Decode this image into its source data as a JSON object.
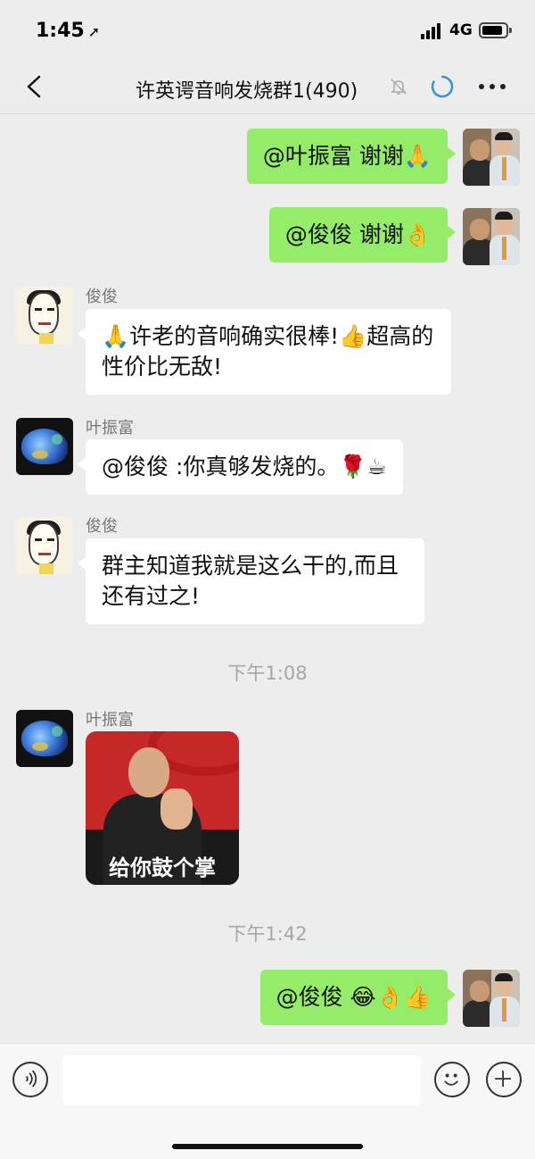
{
  "status_bar": {
    "time": "1:45",
    "network": "4G"
  },
  "nav": {
    "title": "许英谔音响发烧群1(490)"
  },
  "messages": [
    {
      "sender": "",
      "text": "@叶振富 谢谢🙏"
    },
    {
      "sender": "",
      "text": "@俊俊 谢谢👌"
    },
    {
      "sender": "俊俊",
      "text": "🙏许老的音响确实很棒!👍超高的性价比无敌!"
    },
    {
      "sender": "叶振富",
      "text": "@俊俊 :你真够发烧的。🌹☕"
    },
    {
      "sender": "俊俊",
      "text": "群主知道我就是这么干的,而且还有过之!"
    },
    {
      "sender": "叶振富",
      "sticker_caption": "给你鼓个掌"
    },
    {
      "sender": "",
      "text": "@俊俊 😂👌👍"
    }
  ],
  "timestamps": [
    "下午1:08",
    "下午1:42"
  ],
  "icons": {
    "back": "chevron-left-icon",
    "mute": "bell-muted-icon",
    "loading": "loading-circle-icon",
    "more": "more-dots-icon",
    "voice": "voice-icon",
    "emoji": "smiley-icon",
    "plus": "plus-icon"
  },
  "colors": {
    "outgoing_bubble": "#95ec69",
    "incoming_bubble": "#ffffff",
    "background": "#ededed",
    "loading_ring": "#3a8ee6"
  },
  "input": {
    "value": ""
  }
}
